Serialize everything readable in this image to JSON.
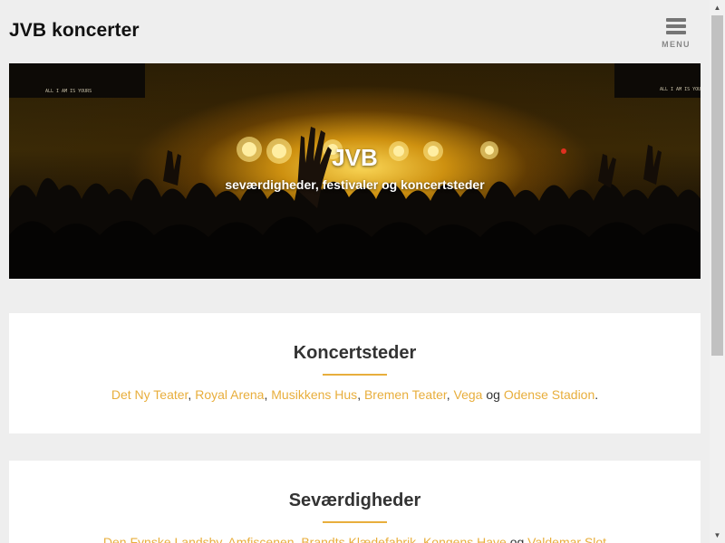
{
  "header": {
    "site_title": "JVB koncerter",
    "menu_label": "MENU",
    "menu_icon": "hamburger-icon"
  },
  "hero": {
    "title": "JVB",
    "subtitle": "seværdigheder, festivaler og koncertsteder",
    "image": "concert-crowd-stage-lights"
  },
  "sections": [
    {
      "heading": "Koncertsteder",
      "links": [
        "Det Ny Teater",
        "Royal Arena",
        "Musikkens Hus",
        "Bremen Teater",
        "Vega",
        "Odense Stadion"
      ],
      "separators": [
        ", ",
        ", ",
        ", ",
        ", ",
        " og ",
        "."
      ]
    },
    {
      "heading": "Seværdigheder",
      "links": [
        "Den Fynske Landsby",
        "Amfiscenen",
        "Brandts Klædefabrik",
        "Kongens Have",
        "Valdemar Slot"
      ],
      "separators": [
        ", ",
        ", ",
        ", ",
        " og ",
        ""
      ]
    }
  ],
  "colors": {
    "accent": "#e8ae3c",
    "background": "#eeeeee",
    "card": "#ffffff",
    "text": "#333333"
  }
}
